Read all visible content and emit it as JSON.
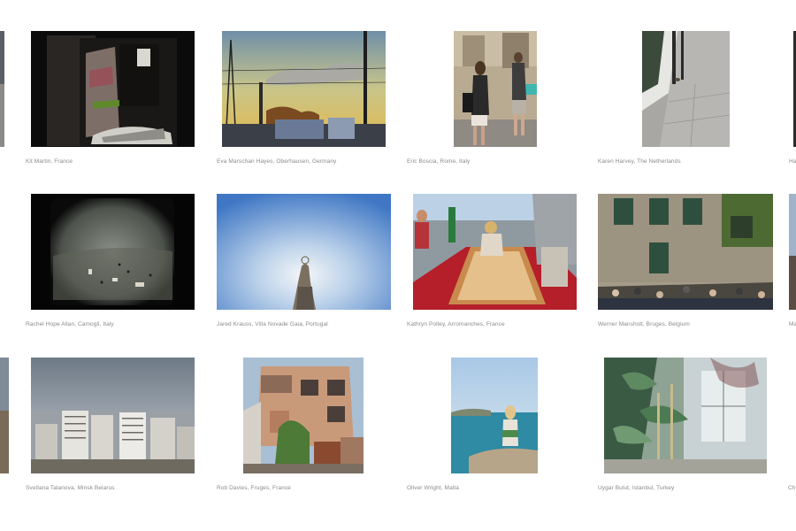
{
  "gallery": {
    "row1": [
      {
        "caption": "Kit Martin, France"
      },
      {
        "caption": "Eva Marschan Hayes, Oberhausen, Germany"
      },
      {
        "caption": "Eric Boscia, Rome, Italy"
      },
      {
        "caption": "Karen Harvey, The Netherlands"
      },
      {
        "caption": "Ha"
      }
    ],
    "row2": [
      {
        "caption": "Rachel Hope Allan, Camogli, Italy"
      },
      {
        "caption": "Jared Krauss, Villa Novade Gaia, Portugal"
      },
      {
        "caption": "Kathryn Polley, Arromanches, France"
      },
      {
        "caption": "Werner Mansholt, Bruges, Belgium"
      },
      {
        "caption": "Ma"
      }
    ],
    "row3": [
      {
        "caption": "Svetlana Talanova, Minsk Belarus"
      },
      {
        "caption": "Rob Davies, Fruges, France"
      },
      {
        "caption": "Oliver Wright, Malta"
      },
      {
        "caption": "Uygar Bulut, Istanbul, Turkey"
      },
      {
        "caption": "Ch"
      }
    ]
  }
}
